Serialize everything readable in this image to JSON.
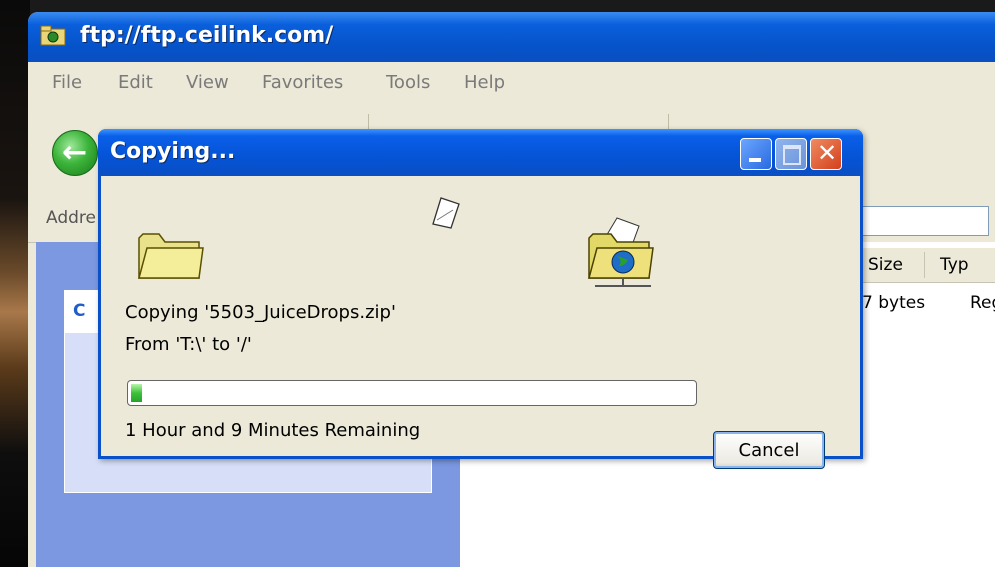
{
  "explorer": {
    "title": "ftp://ftp.ceilink.com/",
    "menu": [
      "File",
      "Edit",
      "View",
      "Favorites",
      "Tools",
      "Help"
    ],
    "address_label": "Addre",
    "task_pane_visible_letter": "C",
    "columns": [
      "Size",
      "Typ"
    ],
    "file_row": {
      "size": "7 bytes",
      "type": "Regi"
    }
  },
  "dialog": {
    "title": "Copying...",
    "copying_text": "Copying '5503_JuiceDrops.zip'",
    "from_text": "From 'T:\\' to '/'",
    "progress": 0.02,
    "time_remaining": "1 Hour and 9 Minutes Remaining",
    "cancel_label": "Cancel"
  },
  "colors": {
    "titlebar_blue": "#0a5fe8",
    "dialog_bg": "#ece9d8",
    "progress_green": "#3cc23a",
    "close_red": "#d2401c"
  },
  "icons": [
    "ftp-folder-icon",
    "back-arrow-icon",
    "folder-icon",
    "globe-folder-icon",
    "flying-document-icon",
    "minimize-icon",
    "maximize-icon",
    "close-icon"
  ]
}
